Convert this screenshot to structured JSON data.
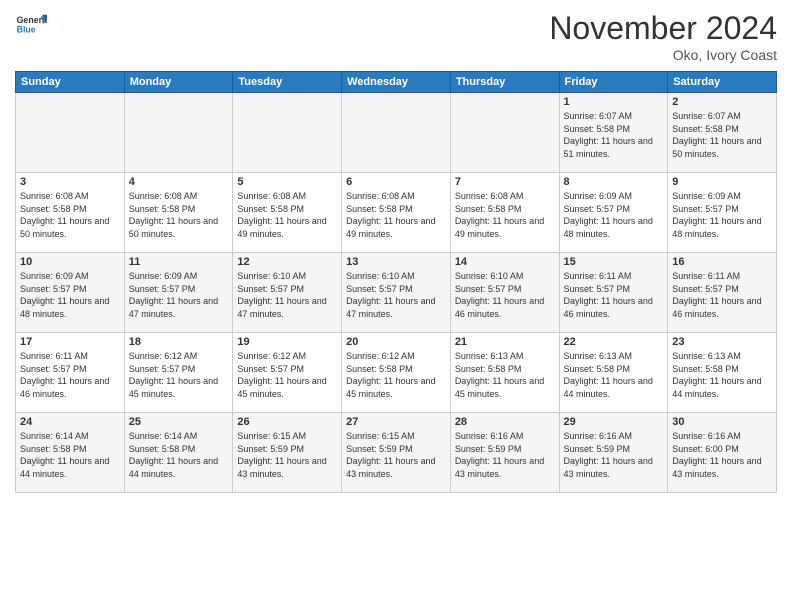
{
  "logo": {
    "general": "General",
    "blue": "Blue"
  },
  "title": "November 2024",
  "location": "Oko, Ivory Coast",
  "days_header": [
    "Sunday",
    "Monday",
    "Tuesday",
    "Wednesday",
    "Thursday",
    "Friday",
    "Saturday"
  ],
  "weeks": [
    [
      {
        "day": "",
        "sunrise": "",
        "sunset": "",
        "daylight": ""
      },
      {
        "day": "",
        "sunrise": "",
        "sunset": "",
        "daylight": ""
      },
      {
        "day": "",
        "sunrise": "",
        "sunset": "",
        "daylight": ""
      },
      {
        "day": "",
        "sunrise": "",
        "sunset": "",
        "daylight": ""
      },
      {
        "day": "",
        "sunrise": "",
        "sunset": "",
        "daylight": ""
      },
      {
        "day": "1",
        "sunrise": "Sunrise: 6:07 AM",
        "sunset": "Sunset: 5:58 PM",
        "daylight": "Daylight: 11 hours and 51 minutes."
      },
      {
        "day": "2",
        "sunrise": "Sunrise: 6:07 AM",
        "sunset": "Sunset: 5:58 PM",
        "daylight": "Daylight: 11 hours and 50 minutes."
      }
    ],
    [
      {
        "day": "3",
        "sunrise": "Sunrise: 6:08 AM",
        "sunset": "Sunset: 5:58 PM",
        "daylight": "Daylight: 11 hours and 50 minutes."
      },
      {
        "day": "4",
        "sunrise": "Sunrise: 6:08 AM",
        "sunset": "Sunset: 5:58 PM",
        "daylight": "Daylight: 11 hours and 50 minutes."
      },
      {
        "day": "5",
        "sunrise": "Sunrise: 6:08 AM",
        "sunset": "Sunset: 5:58 PM",
        "daylight": "Daylight: 11 hours and 49 minutes."
      },
      {
        "day": "6",
        "sunrise": "Sunrise: 6:08 AM",
        "sunset": "Sunset: 5:58 PM",
        "daylight": "Daylight: 11 hours and 49 minutes."
      },
      {
        "day": "7",
        "sunrise": "Sunrise: 6:08 AM",
        "sunset": "Sunset: 5:58 PM",
        "daylight": "Daylight: 11 hours and 49 minutes."
      },
      {
        "day": "8",
        "sunrise": "Sunrise: 6:09 AM",
        "sunset": "Sunset: 5:57 PM",
        "daylight": "Daylight: 11 hours and 48 minutes."
      },
      {
        "day": "9",
        "sunrise": "Sunrise: 6:09 AM",
        "sunset": "Sunset: 5:57 PM",
        "daylight": "Daylight: 11 hours and 48 minutes."
      }
    ],
    [
      {
        "day": "10",
        "sunrise": "Sunrise: 6:09 AM",
        "sunset": "Sunset: 5:57 PM",
        "daylight": "Daylight: 11 hours and 48 minutes."
      },
      {
        "day": "11",
        "sunrise": "Sunrise: 6:09 AM",
        "sunset": "Sunset: 5:57 PM",
        "daylight": "Daylight: 11 hours and 47 minutes."
      },
      {
        "day": "12",
        "sunrise": "Sunrise: 6:10 AM",
        "sunset": "Sunset: 5:57 PM",
        "daylight": "Daylight: 11 hours and 47 minutes."
      },
      {
        "day": "13",
        "sunrise": "Sunrise: 6:10 AM",
        "sunset": "Sunset: 5:57 PM",
        "daylight": "Daylight: 11 hours and 47 minutes."
      },
      {
        "day": "14",
        "sunrise": "Sunrise: 6:10 AM",
        "sunset": "Sunset: 5:57 PM",
        "daylight": "Daylight: 11 hours and 46 minutes."
      },
      {
        "day": "15",
        "sunrise": "Sunrise: 6:11 AM",
        "sunset": "Sunset: 5:57 PM",
        "daylight": "Daylight: 11 hours and 46 minutes."
      },
      {
        "day": "16",
        "sunrise": "Sunrise: 6:11 AM",
        "sunset": "Sunset: 5:57 PM",
        "daylight": "Daylight: 11 hours and 46 minutes."
      }
    ],
    [
      {
        "day": "17",
        "sunrise": "Sunrise: 6:11 AM",
        "sunset": "Sunset: 5:57 PM",
        "daylight": "Daylight: 11 hours and 46 minutes."
      },
      {
        "day": "18",
        "sunrise": "Sunrise: 6:12 AM",
        "sunset": "Sunset: 5:57 PM",
        "daylight": "Daylight: 11 hours and 45 minutes."
      },
      {
        "day": "19",
        "sunrise": "Sunrise: 6:12 AM",
        "sunset": "Sunset: 5:57 PM",
        "daylight": "Daylight: 11 hours and 45 minutes."
      },
      {
        "day": "20",
        "sunrise": "Sunrise: 6:12 AM",
        "sunset": "Sunset: 5:58 PM",
        "daylight": "Daylight: 11 hours and 45 minutes."
      },
      {
        "day": "21",
        "sunrise": "Sunrise: 6:13 AM",
        "sunset": "Sunset: 5:58 PM",
        "daylight": "Daylight: 11 hours and 45 minutes."
      },
      {
        "day": "22",
        "sunrise": "Sunrise: 6:13 AM",
        "sunset": "Sunset: 5:58 PM",
        "daylight": "Daylight: 11 hours and 44 minutes."
      },
      {
        "day": "23",
        "sunrise": "Sunrise: 6:13 AM",
        "sunset": "Sunset: 5:58 PM",
        "daylight": "Daylight: 11 hours and 44 minutes."
      }
    ],
    [
      {
        "day": "24",
        "sunrise": "Sunrise: 6:14 AM",
        "sunset": "Sunset: 5:58 PM",
        "daylight": "Daylight: 11 hours and 44 minutes."
      },
      {
        "day": "25",
        "sunrise": "Sunrise: 6:14 AM",
        "sunset": "Sunset: 5:58 PM",
        "daylight": "Daylight: 11 hours and 44 minutes."
      },
      {
        "day": "26",
        "sunrise": "Sunrise: 6:15 AM",
        "sunset": "Sunset: 5:59 PM",
        "daylight": "Daylight: 11 hours and 43 minutes."
      },
      {
        "day": "27",
        "sunrise": "Sunrise: 6:15 AM",
        "sunset": "Sunset: 5:59 PM",
        "daylight": "Daylight: 11 hours and 43 minutes."
      },
      {
        "day": "28",
        "sunrise": "Sunrise: 6:16 AM",
        "sunset": "Sunset: 5:59 PM",
        "daylight": "Daylight: 11 hours and 43 minutes."
      },
      {
        "day": "29",
        "sunrise": "Sunrise: 6:16 AM",
        "sunset": "Sunset: 5:59 PM",
        "daylight": "Daylight: 11 hours and 43 minutes."
      },
      {
        "day": "30",
        "sunrise": "Sunrise: 6:16 AM",
        "sunset": "Sunset: 6:00 PM",
        "daylight": "Daylight: 11 hours and 43 minutes."
      }
    ]
  ]
}
